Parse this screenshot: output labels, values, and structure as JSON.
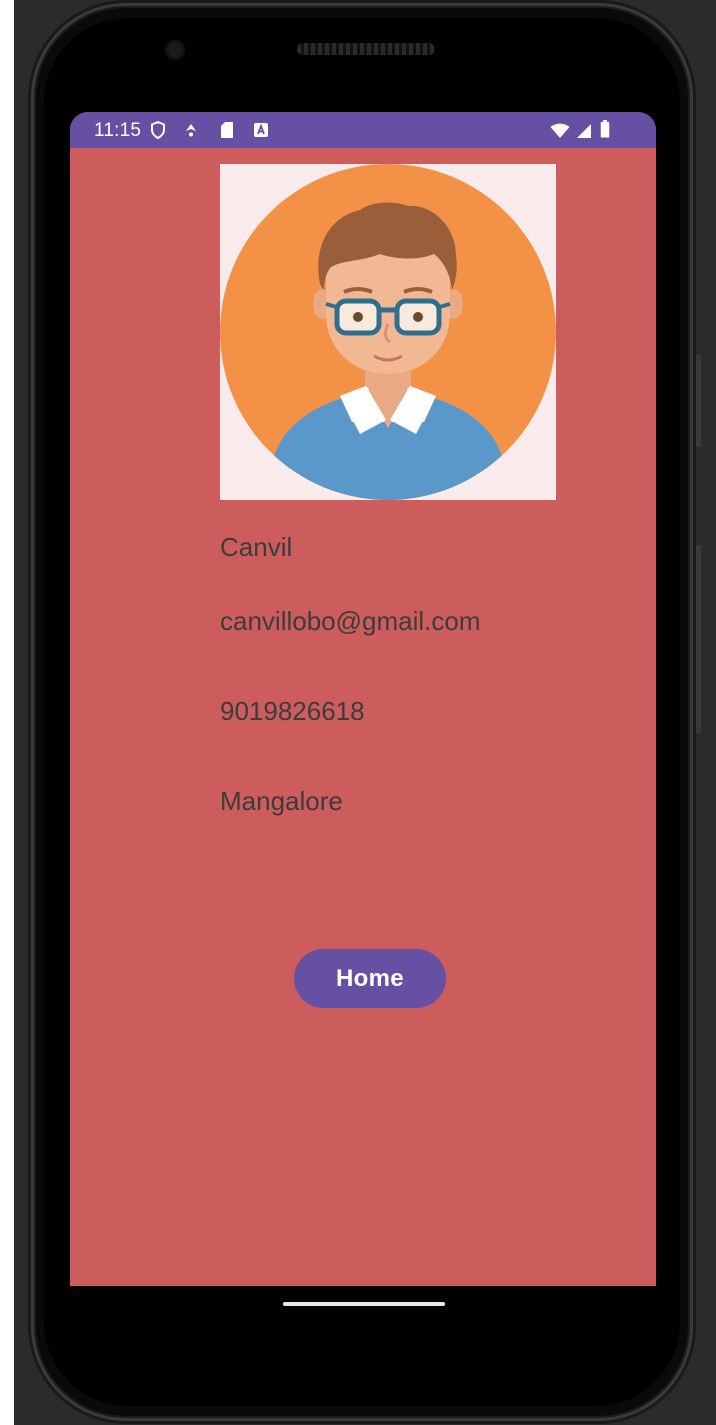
{
  "status_bar": {
    "time": "11:15",
    "left_icons": [
      "shield-icon",
      "location-icon",
      "sim-card-icon",
      "notification-a-icon"
    ],
    "right_icons": [
      "wifi-icon",
      "signal-icon",
      "battery-icon"
    ]
  },
  "profile": {
    "name": "Canvil",
    "email": "canvillobo@gmail.com",
    "phone": "9019826618",
    "city": "Mangalore"
  },
  "actions": {
    "home_label": "Home"
  },
  "colors": {
    "screen_background": "#cd5c5c",
    "accent": "#6650a4",
    "avatar_circle": "#f39147",
    "avatar_background": "#f9ebeb"
  }
}
